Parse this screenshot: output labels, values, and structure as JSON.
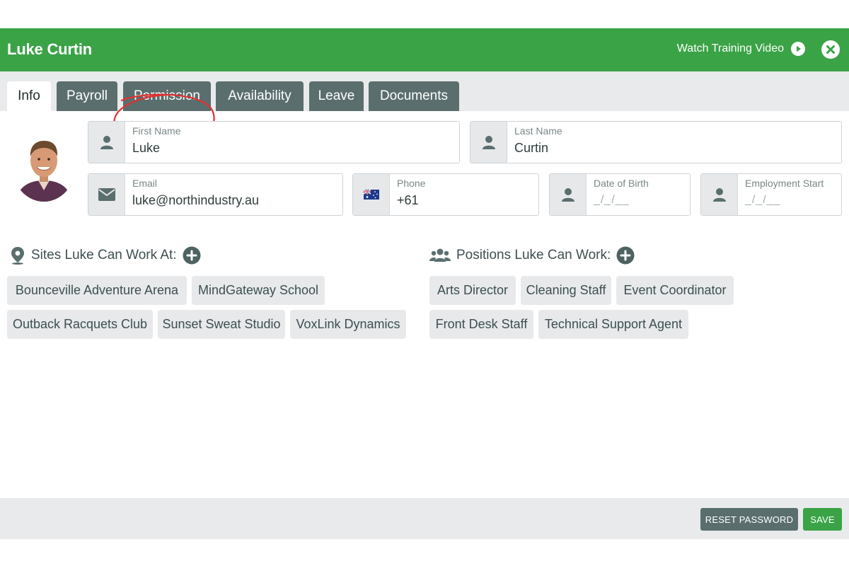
{
  "header": {
    "title": "Luke Curtin",
    "training_label": "Watch Training Video"
  },
  "tabs": [
    {
      "label": "Info",
      "active": true
    },
    {
      "label": "Payroll",
      "active": false
    },
    {
      "label": "Permission",
      "active": false
    },
    {
      "label": "Availability",
      "active": false
    },
    {
      "label": "Leave",
      "active": false
    },
    {
      "label": "Documents",
      "active": false
    }
  ],
  "fields": {
    "first_name": {
      "label": "First Name",
      "value": "Luke"
    },
    "last_name": {
      "label": "Last Name",
      "value": "Curtin"
    },
    "email": {
      "label": "Email",
      "value": "luke@northindustry.au"
    },
    "phone": {
      "label": "Phone",
      "value": "+61"
    },
    "dob": {
      "label": "Date of Birth",
      "placeholder": "_/_/__"
    },
    "employment_start": {
      "label": "Employment Start",
      "placeholder": "_/_/__"
    }
  },
  "sites": {
    "heading": "Sites Luke Can Work At:",
    "items": [
      "Bounceville Adventure Arena",
      "MindGateway School",
      "Outback Racquets Club",
      "Sunset Sweat Studio",
      "VoxLink Dynamics"
    ]
  },
  "positions": {
    "heading": "Positions Luke Can Work:",
    "items": [
      "Arts Director",
      "Cleaning Staff",
      "Event Coordinator",
      "Front Desk Staff",
      "Technical Support Agent"
    ]
  },
  "footer": {
    "reset_label": "RESET PASSWORD",
    "save_label": "SAVE"
  },
  "colors": {
    "brand_green": "#3aa346",
    "tab_slate": "#5a6e6e",
    "annotation_red": "#e03131"
  }
}
